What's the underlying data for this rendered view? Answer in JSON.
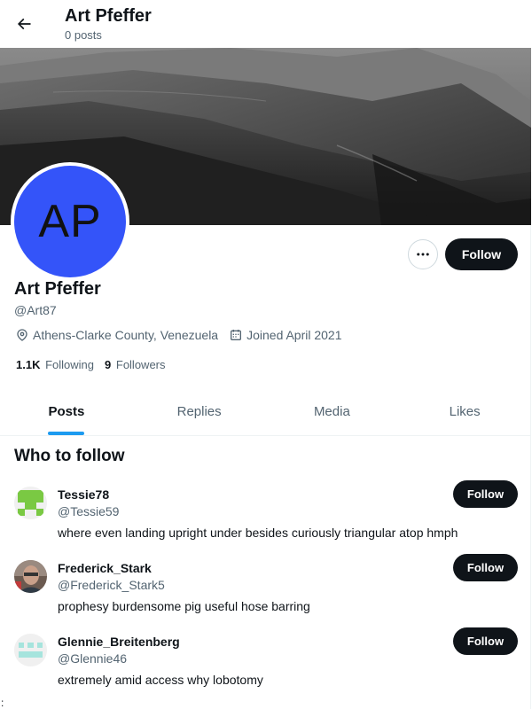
{
  "header": {
    "title": "Art Pfeffer",
    "posts_count": "0 posts"
  },
  "profile": {
    "avatar_initials": "AP",
    "avatar_color": "#3454f9",
    "display_name": "Art Pfeffer",
    "handle": "@Art87",
    "location": "Athens-Clarke County, Venezuela",
    "joined": "Joined April 2021",
    "following_count": "1.1K",
    "following_label": "Following",
    "followers_count": "9",
    "followers_label": "Followers",
    "follow_label": "Follow"
  },
  "tabs": [
    {
      "label": "Posts",
      "active": true
    },
    {
      "label": "Replies",
      "active": false
    },
    {
      "label": "Media",
      "active": false
    },
    {
      "label": "Likes",
      "active": false
    }
  ],
  "who_to_follow": {
    "title": "Who to follow",
    "suggestions": [
      {
        "name": "Tessie78",
        "handle": "@Tessie59",
        "bio": "where even landing upright under besides curiously triangular atop hmph",
        "follow_label": "Follow",
        "avatar_icon": "green-identicon"
      },
      {
        "name": "Frederick_Stark",
        "handle": "@Frederick_Stark5",
        "bio": "prophesy burdensome pig useful hose barring",
        "follow_label": "Follow",
        "avatar_icon": "photo-avatar"
      },
      {
        "name": "Glennie_Breitenberg",
        "handle": "@Glennie46",
        "bio": "extremely amid access why lobotomy",
        "follow_label": "Follow",
        "avatar_icon": "teal-identicon"
      }
    ]
  },
  "colors": {
    "accent": "#1d9bf0",
    "button_dark": "#0f1419",
    "secondary_text": "#536471"
  },
  "stray_text": ":"
}
